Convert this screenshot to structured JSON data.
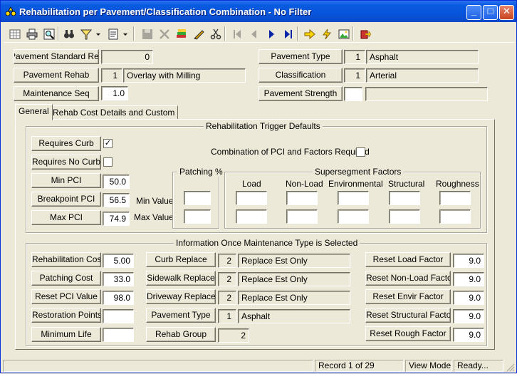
{
  "window": {
    "title": "Rehabilitation per Pavement/Classification Combination - No Filter",
    "minimize_glyph": "_",
    "maximize_glyph": "□",
    "close_glyph": "✕"
  },
  "toolbar": {
    "icons": [
      "grid-icon",
      "print-icon",
      "print-preview-icon",
      "binoculars-icon",
      "filter-icon",
      "dropdown-arrow-icon",
      "form-icon",
      "dropdown-arrow-icon",
      "save-icon",
      "delete-icon",
      "stack-icon",
      "pencil-icon",
      "scissors-icon",
      "first-record-icon",
      "previous-record-icon",
      "next-record-icon",
      "last-record-icon",
      "arrow-right-icon",
      "lightning-icon",
      "image-icon",
      "exit-icon"
    ]
  },
  "header": {
    "pavement_standard_rec_label": "Pavement Standard Rec",
    "pavement_standard_rec_value": "0",
    "pavement_rehab_label": "Pavement Rehab",
    "pavement_rehab_code": "1",
    "pavement_rehab_value": "Overlay with Milling",
    "maintenance_seq_label": "Maintenance Seq",
    "maintenance_seq_value": "1.0",
    "pavement_type_label": "Pavement Type",
    "pavement_type_code": "1",
    "pavement_type_value": "Asphalt",
    "classification_label": "Classification",
    "classification_code": "1",
    "classification_value": "Arterial",
    "pavement_strength_label": "Pavement Strength",
    "pavement_strength_code": "",
    "pavement_strength_value": ""
  },
  "tabs": [
    {
      "label": "General",
      "active": true
    },
    {
      "label": "Rehab Cost Details and Custom",
      "active": false
    }
  ],
  "trigger": {
    "title": "Rehabilitation Trigger Defaults",
    "requires_curb_label": "Requires Curb",
    "requires_curb_mark": "✓",
    "requires_no_curb_label": "Requires No Curb",
    "combination_label": "Combination of PCI and  Factors Required",
    "min_pci_label": "Min PCI",
    "min_pci_value": "50.0",
    "breakpoint_pci_label": "Breakpoint PCI",
    "breakpoint_pci_value": "56.5",
    "max_pci_label": "Max PCI",
    "max_pci_value": "74.9",
    "min_value_label": "Min Value",
    "max_value_label": "Max Value",
    "patching_title": "Patching %",
    "supersegment_title": "Supersegment Factors",
    "factor_headers": [
      "Load",
      "Non-Load",
      "Environmental",
      "Structural",
      "Roughness"
    ]
  },
  "info": {
    "title": "Information Once Maintenance Type is Selected",
    "left": [
      {
        "label": "Rehabilitation Cost",
        "value": "5.00"
      },
      {
        "label": "Patching Cost",
        "value": "33.0"
      },
      {
        "label": "Reset PCI Value",
        "value": "98.0"
      },
      {
        "label": "Restoration Points",
        "value": ""
      },
      {
        "label": "Minimum Life",
        "value": ""
      }
    ],
    "middle": [
      {
        "label": "Curb Replace",
        "code": "2",
        "value": "Replace Est Only"
      },
      {
        "label": "Sidewalk Replace",
        "code": "2",
        "value": "Replace Est Only"
      },
      {
        "label": "Driveway Replace",
        "code": "2",
        "value": "Replace Est Only"
      },
      {
        "label": "Pavement Type",
        "code": "1",
        "value": "Asphalt"
      }
    ],
    "rehab_group_label": "Rehab Group",
    "rehab_group_value": "2",
    "right": [
      {
        "label": "Reset Load Factor",
        "value": "9.0"
      },
      {
        "label": "Reset Non-Load Factor",
        "value": "9.0"
      },
      {
        "label": "Reset Envir Factor",
        "value": "9.0"
      },
      {
        "label": "Reset Structural Factor",
        "value": "9.0"
      },
      {
        "label": "Reset Rough Factor",
        "value": "9.0"
      }
    ]
  },
  "status": {
    "record": "Record 1 of 29",
    "mode": "View Mode",
    "state": "Ready..."
  }
}
